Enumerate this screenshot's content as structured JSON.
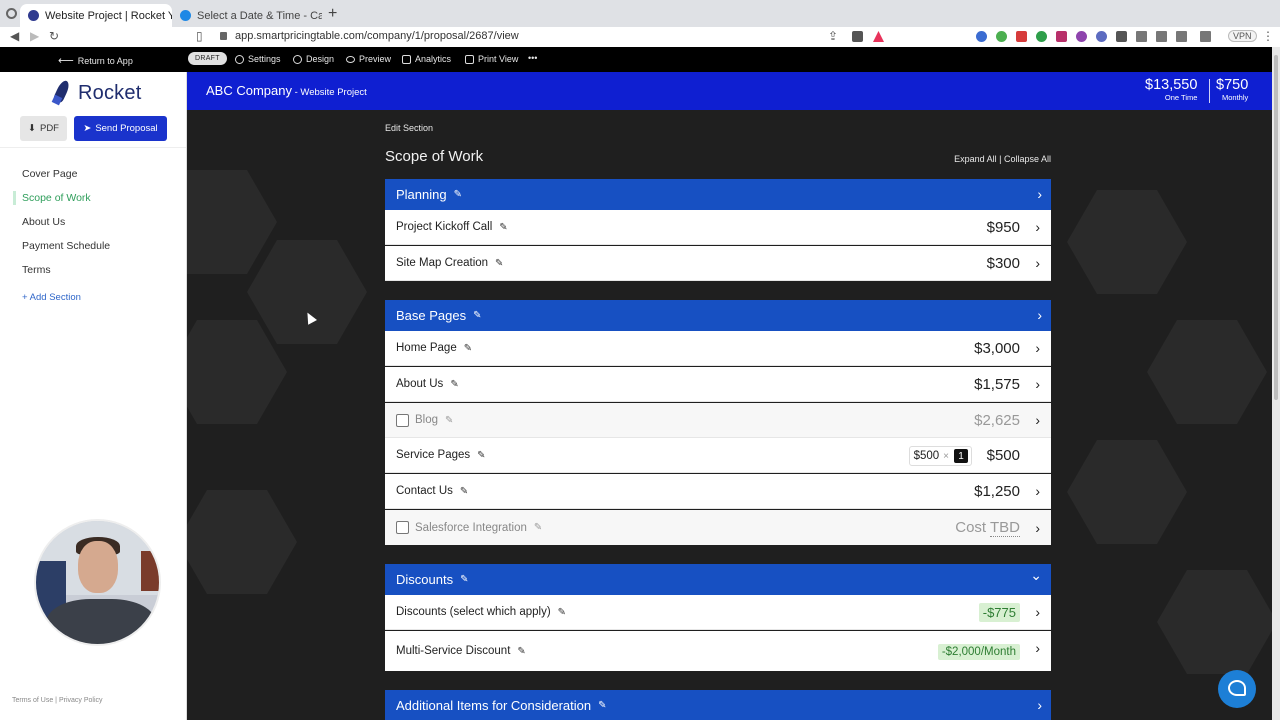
{
  "browser": {
    "tabs": [
      {
        "title": "Website Project | Rocket You A...",
        "close": "×"
      },
      {
        "title": "Select a Date & Time - Calendly"
      }
    ],
    "new_tab": "+",
    "url": "app.smartpricingtable.com/company/1/proposal/2687/view",
    "vpn": "VPN"
  },
  "appbar": {
    "return": "Return to App",
    "status": "DRAFT",
    "settings": "Settings",
    "design": "Design",
    "preview": "Preview",
    "analytics": "Analytics",
    "print": "Print View",
    "more": "•••"
  },
  "sidebar": {
    "logo": "Rocket",
    "pdf": "PDF",
    "send": "Send Proposal",
    "items": [
      "Cover Page",
      "Scope of Work",
      "About Us",
      "Payment Schedule",
      "Terms"
    ],
    "active_item": "Scope of Work",
    "add_section": "+ Add Section",
    "legal": "Terms of Use | Privacy Policy"
  },
  "header": {
    "company": "ABC Company",
    "project": " - Website Project",
    "one_time_amount": "$13,550",
    "one_time_label": "One Time",
    "monthly_amount": "$750",
    "monthly_label": "Monthly"
  },
  "main": {
    "edit_section": "Edit Section",
    "title": "Scope of Work",
    "expand_collapse": "Expand All | Collapse All",
    "pencil": "✎",
    "chevron_right": "›",
    "chevron_down": "⌄",
    "sections": {
      "planning": {
        "title": "Planning",
        "items": [
          {
            "label": "Project Kickoff Call",
            "price": "$950"
          },
          {
            "label": "Site Map Creation",
            "price": "$300"
          }
        ]
      },
      "base_pages": {
        "title": "Base Pages",
        "items": [
          {
            "label": "Home Page",
            "price": "$3,000"
          },
          {
            "label": "About Us",
            "price": "$1,575"
          },
          {
            "label": "Blog",
            "price": "$2,625",
            "checked": false
          },
          {
            "label": "Service Pages",
            "unit_price": "$500",
            "times": "×",
            "qty": "1",
            "price": "$500"
          },
          {
            "label": "Contact Us",
            "price": "$1,250"
          },
          {
            "label": "Salesforce Integration",
            "price_prefix": "Cost ",
            "price_tbd": "TBD",
            "checked": false
          }
        ]
      },
      "discounts": {
        "title": "Discounts",
        "items": [
          {
            "label": "Discounts (select which apply)",
            "price": "-$775"
          },
          {
            "label": "Multi-Service Discount",
            "price": "-$2,000/Month"
          }
        ]
      },
      "additional": {
        "title": "Additional Items for Consideration"
      }
    }
  },
  "colors": {
    "brand_blue": "#0f1fd1",
    "section_blue": "#1750c2",
    "send_button": "#1a33cc",
    "active_nav": "#2f9e5b",
    "discount_bg": "#d8f0d2",
    "discount_text": "#2d7d32"
  },
  "icons": [
    "settings-icon",
    "design-icon",
    "preview-icon",
    "analytics-icon",
    "print-icon",
    "download-icon",
    "send-icon",
    "pencil-icon",
    "chevron-right-icon",
    "chevron-down-icon",
    "chat-icon"
  ]
}
